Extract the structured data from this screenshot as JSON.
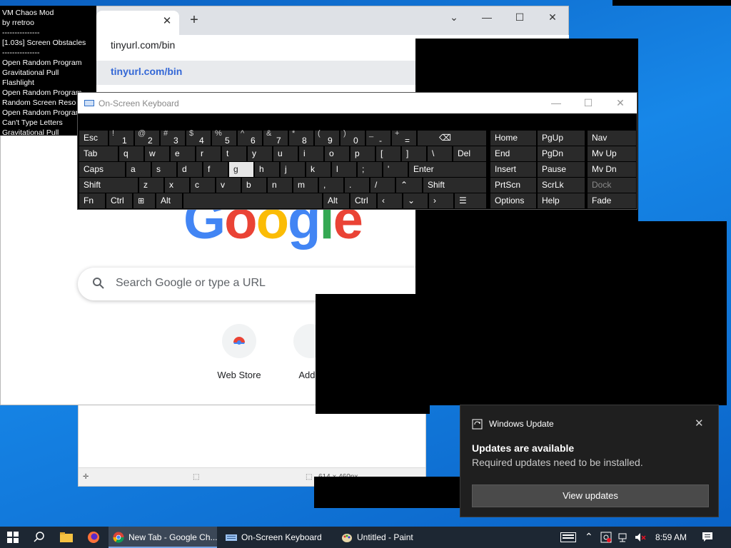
{
  "chaos": {
    "title": "VM Chaos Mod",
    "author": "by rretroo",
    "sep1": "---------------",
    "effect": "[1.03s] Screen Obstacles",
    "sep2": "---------------",
    "history": [
      "Open Random Program",
      "Gravitational Pull",
      "Flashlight",
      "Open Random Program",
      "Random Screen Reso",
      "Open Random Program",
      "Can't Type Letters",
      "Gravitational Pull"
    ]
  },
  "chrome": {
    "omnibox_text": "tinyurl.com/bin",
    "suggestion": "tinyurl.com/bin",
    "search_placeholder": "Search Google or type a URL",
    "shortcut1": "Web Store",
    "shortcut2": "Add s",
    "logo": [
      "G",
      "o",
      "o",
      "g",
      "l",
      "e"
    ]
  },
  "paint": {
    "size_text": "614 × 460px"
  },
  "osk": {
    "title": "On-Screen Keyboard",
    "keys": {
      "esc": "Esc",
      "tab": "Tab",
      "caps": "Caps",
      "shift": "Shift",
      "fn": "Fn",
      "ctrl": "Ctrl",
      "alt": "Alt",
      "enter": "Enter",
      "del": "Del",
      "alt_r": "Alt",
      "ctrl_r": "Ctrl",
      "shift_r": "Shift",
      "home": "Home",
      "pgup": "PgUp",
      "nav": "Nav",
      "end": "End",
      "pgdn": "PgDn",
      "mvup": "Mv Up",
      "insert": "Insert",
      "pause": "Pause",
      "mvdn": "Mv Dn",
      "prtscn": "PrtScn",
      "scrlk": "ScrLk",
      "dock": "Dock",
      "options": "Options",
      "help": "Help",
      "fade": "Fade"
    },
    "row1": [
      "1",
      "2",
      "3",
      "4",
      "5",
      "6",
      "7",
      "8",
      "9",
      "0",
      "-",
      "="
    ],
    "row1_shift": [
      "!",
      "@",
      "#",
      "$",
      "%",
      "^",
      "&",
      "*",
      "(",
      ")",
      "_",
      "+"
    ],
    "row2": [
      "q",
      "w",
      "e",
      "r",
      "t",
      "y",
      "u",
      "i",
      "o",
      "p",
      "[",
      "]",
      "\\"
    ],
    "row3": [
      "a",
      "s",
      "d",
      "f",
      "g",
      "h",
      "j",
      "k",
      "l",
      ";",
      "'"
    ],
    "row4": [
      "z",
      "x",
      "c",
      "v",
      "b",
      "n",
      "m",
      ",",
      ".",
      "/"
    ]
  },
  "toast": {
    "app": "Windows Update",
    "title": "Updates are available",
    "body": "Required updates need to be installed.",
    "button": "View updates"
  },
  "taskbar": {
    "apps": [
      "New Tab - Google Ch...",
      "On-Screen Keyboard",
      "Untitled - Paint"
    ],
    "clock": "8:59 AM"
  }
}
